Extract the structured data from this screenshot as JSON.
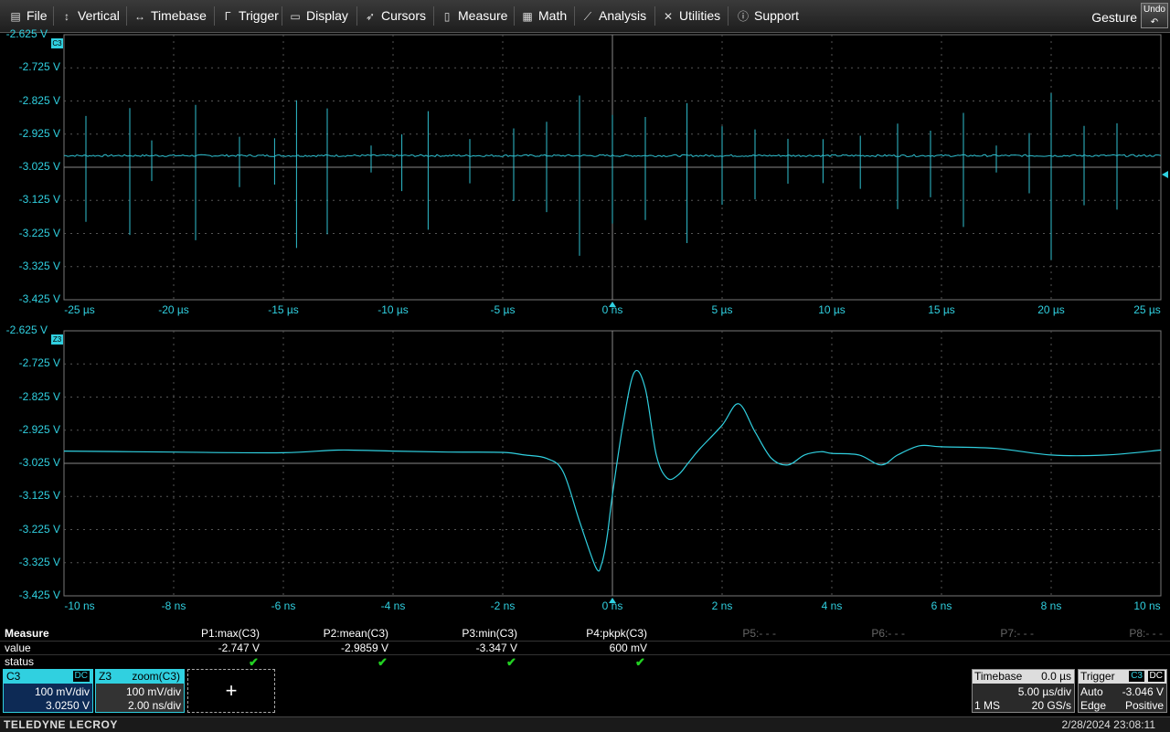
{
  "menu": {
    "items": [
      {
        "label": "File",
        "icon": "file-icon"
      },
      {
        "label": "Vertical",
        "icon": "vertical-arrows-icon"
      },
      {
        "label": "Timebase",
        "icon": "horizontal-arrows-icon"
      },
      {
        "label": "Trigger",
        "icon": "trigger-edge-icon"
      },
      {
        "label": "Display",
        "icon": "display-icon"
      },
      {
        "label": "Cursors",
        "icon": "cursor-icon"
      },
      {
        "label": "Measure",
        "icon": "measure-icon"
      },
      {
        "label": "Math",
        "icon": "math-icon"
      },
      {
        "label": "Analysis",
        "icon": "analysis-chart-icon"
      },
      {
        "label": "Utilities",
        "icon": "tools-icon"
      },
      {
        "label": "Support",
        "icon": "info-icon"
      }
    ],
    "gesture": "Gesture",
    "undo": "Undo"
  },
  "grid1": {
    "tag": "C3",
    "ylabels": [
      "-2.625 V",
      "-2.725 V",
      "-2.825 V",
      "-2.925 V",
      "-3.025 V",
      "-3.125 V",
      "-3.225 V",
      "-3.325 V",
      "-3.425 V"
    ],
    "xlabels": [
      "-25 µs",
      "-20 µs",
      "-15 µs",
      "-10 µs",
      "-5 µs",
      "0 ns",
      "5 µs",
      "10 µs",
      "15 µs",
      "20 µs",
      "25 µs"
    ]
  },
  "grid2": {
    "tag": "Z3",
    "ylabels": [
      "-2.625 V",
      "-2.725 V",
      "-2.825 V",
      "-2.925 V",
      "-3.025 V",
      "-3.125 V",
      "-3.225 V",
      "-3.325 V",
      "-3.425 V"
    ],
    "xlabels": [
      "-10 ns",
      "-8 ns",
      "-6 ns",
      "-4 ns",
      "-2 ns",
      "0 ns",
      "2 ns",
      "4 ns",
      "6 ns",
      "8 ns",
      "10 ns"
    ]
  },
  "measure": {
    "title": "Measure",
    "row_value": "value",
    "row_status": "status",
    "params": [
      {
        "name": "P1:max(C3)",
        "value": "-2.747 V",
        "status": "✔"
      },
      {
        "name": "P2:mean(C3)",
        "value": "-2.9859 V",
        "status": "✔"
      },
      {
        "name": "P3:min(C3)",
        "value": "-3.347 V",
        "status": "✔"
      },
      {
        "name": "P4:pkpk(C3)",
        "value": "600 mV",
        "status": "✔"
      },
      {
        "name": "P5:- - -",
        "value": "",
        "status": ""
      },
      {
        "name": "P6:- - -",
        "value": "",
        "status": ""
      },
      {
        "name": "P7:- - -",
        "value": "",
        "status": ""
      },
      {
        "name": "P8:- - -",
        "value": "",
        "status": ""
      }
    ]
  },
  "c3": {
    "name": "C3",
    "coupling": "DC",
    "vdiv": "100 mV/div",
    "offset": "3.0250 V"
  },
  "z3": {
    "name": "Z3",
    "source": "zoom(C3)",
    "vdiv": "100 mV/div",
    "tdiv": "2.00 ns/div"
  },
  "add_trace": "+",
  "timebase": {
    "title": "Timebase",
    "delay": "0.0 µs",
    "tdiv": "5.00 µs/div",
    "points": "1 MS",
    "rate": "20 GS/s"
  },
  "trigger": {
    "title": "Trigger",
    "source": "C3",
    "coupling": "DC",
    "mode": "Auto",
    "level": "-3.046 V",
    "type": "Edge",
    "slope": "Positive"
  },
  "footer": {
    "brand": "TELEDYNE LECROY",
    "datetime": "2/28/2024 23:08:11"
  },
  "colors": {
    "trace": "#30d0e0",
    "grid": "#6a6a6a",
    "ok": "#22d022"
  },
  "chart_data": [
    {
      "type": "line",
      "name": "C3",
      "xunit": "µs",
      "yunit": "V",
      "xlim": [
        -25,
        25
      ],
      "ylim": [
        -3.425,
        -2.625
      ],
      "baseline": -2.99,
      "spike_times": [
        -24,
        -22,
        -21,
        -19,
        -17,
        -15.4,
        -14.4,
        -13,
        -11,
        -9.6,
        -8.4,
        -6.5,
        -4.5,
        -3,
        -1.5,
        0,
        1.5,
        3.4,
        5,
        6.5,
        8,
        9.6,
        11.3,
        13,
        14.5,
        16,
        17.5,
        19,
        20,
        21.5,
        23
      ]
    },
    {
      "type": "line",
      "name": "Z3",
      "xunit": "ns",
      "yunit": "V",
      "xlim": [
        -10,
        10
      ],
      "ylim": [
        -3.425,
        -2.625
      ],
      "x": [
        -10,
        -8,
        -6,
        -5,
        -4,
        -3,
        -2,
        -1.6,
        -1.2,
        -0.9,
        -0.6,
        -0.3,
        -0.2,
        -0.1,
        0,
        0.2,
        0.4,
        0.6,
        0.8,
        1,
        1.2,
        1.4,
        1.6,
        2,
        2.3,
        2.6,
        2.9,
        3.2,
        3.5,
        3.8,
        4,
        4.5,
        4.9,
        5.2,
        5.6,
        6,
        7,
        8,
        9,
        10
      ],
      "y": [
        -2.988,
        -2.991,
        -2.993,
        -2.985,
        -2.988,
        -2.991,
        -2.992,
        -3.0,
        -3.01,
        -3.05,
        -3.2,
        -3.34,
        -3.33,
        -3.25,
        -3.12,
        -2.9,
        -2.75,
        -2.8,
        -3.0,
        -3.07,
        -3.06,
        -3.02,
        -2.98,
        -2.91,
        -2.845,
        -2.93,
        -3.01,
        -3.03,
        -3.0,
        -2.99,
        -2.995,
        -3.0,
        -3.03,
        -3.0,
        -2.972,
        -2.975,
        -2.98,
        -3.0,
        -3.0,
        -2.985
      ]
    }
  ]
}
